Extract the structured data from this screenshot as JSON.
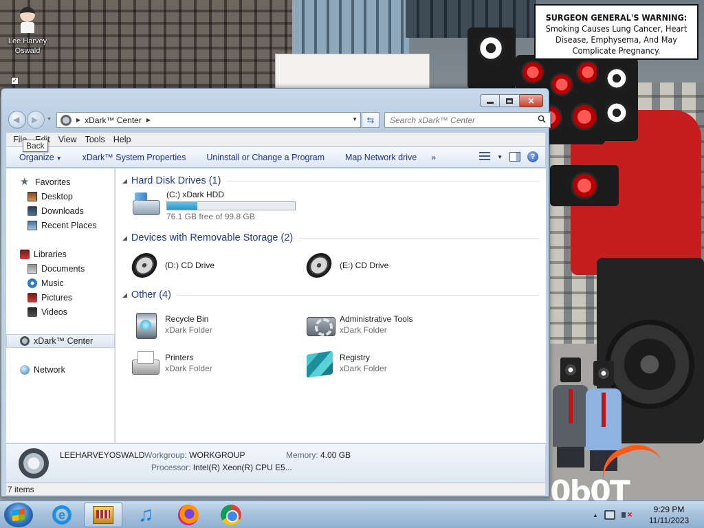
{
  "desktop": {
    "icon_label_line1": "Lee Harvey",
    "icon_label_line2": "Oswald",
    "warning_title": "SURGEON GENERAL'S WARNING:",
    "warning_body": "Smoking Causes Lung Cancer, Heart Disease, Emphysema, And May Complicate Pregnancy.",
    "corner_logo": "0b0T"
  },
  "window": {
    "address_crumb": "xDark™ Center",
    "search_placeholder": "Search xDark™ Center",
    "back_tooltip": "Back",
    "menu": [
      "File",
      "Edit",
      "View",
      "Tools",
      "Help"
    ],
    "toolbar": {
      "organize": "Organize",
      "system_properties": "xDark™ System Properties",
      "uninstall": "Uninstall or Change a Program",
      "map_drive": "Map Network drive",
      "more": "»"
    },
    "nav": {
      "favorites": "Favorites",
      "desktop": "Desktop",
      "downloads": "Downloads",
      "recent": "Recent Places",
      "libraries": "Libraries",
      "documents": "Documents",
      "music": "Music",
      "pictures": "Pictures",
      "videos": "Videos",
      "center": "xDark™ Center",
      "network": "Network"
    },
    "groups": {
      "hdd": "Hard Disk Drives (1)",
      "removable": "Devices with Removable Storage (2)",
      "other": "Other (4)"
    },
    "drives": {
      "c_name": "(C:) xDark HDD",
      "c_free": "76.1 GB free of 99.8 GB",
      "c_used_fraction": 0.237,
      "d_name": "(D:) CD Drive",
      "e_name": "(E:) CD Drive"
    },
    "other_items": [
      {
        "name": "Recycle Bin",
        "type": "xDark Folder"
      },
      {
        "name": "Administrative Tools",
        "type": "xDark Folder"
      },
      {
        "name": "Printers",
        "type": "xDark Folder"
      },
      {
        "name": "Registry",
        "type": "xDark Folder"
      }
    ],
    "details": {
      "computer_name": "LEEHARVEYOSWALD",
      "workgroup_label": "Workgroup:",
      "workgroup": "WORKGROUP",
      "memory_label": "Memory:",
      "memory": "4.00 GB",
      "processor_label": "Processor:",
      "processor": "Intel(R) Xeon(R) CPU E5..."
    },
    "status": "7 items"
  },
  "taskbar": {
    "time": "9:29 PM",
    "date": "11/11/2023"
  }
}
